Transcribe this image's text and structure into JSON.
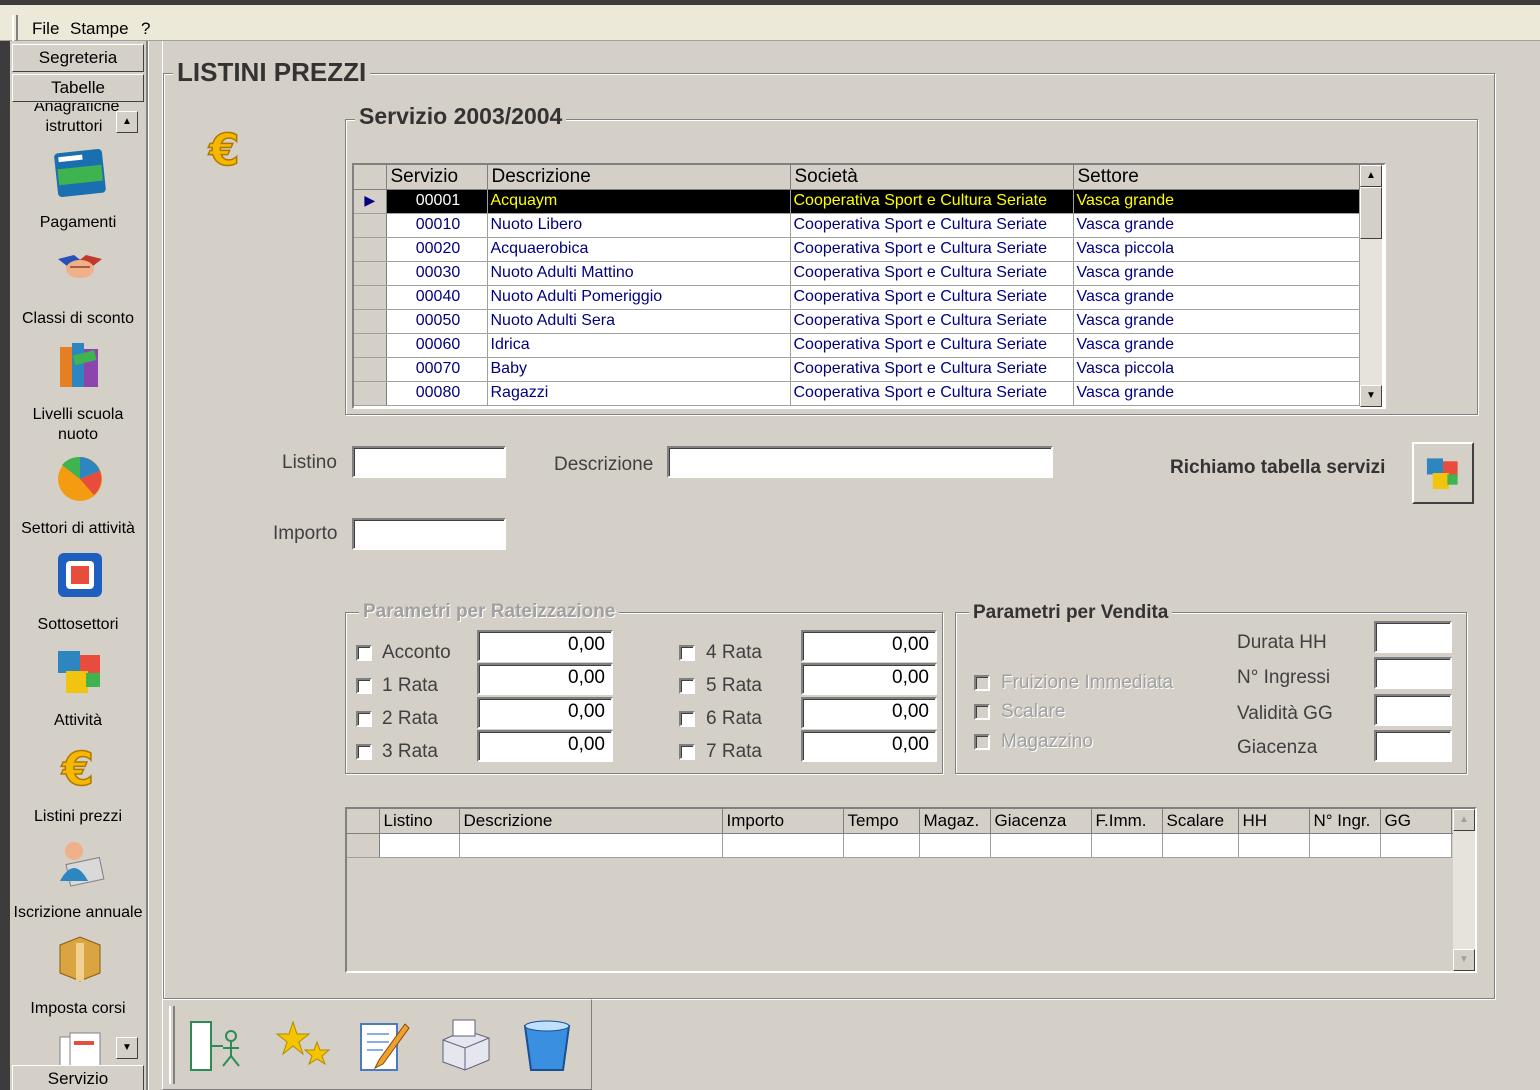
{
  "menu": [
    "File",
    "Stampe",
    "?"
  ],
  "sidebar": {
    "top_buttons": [
      "Segreteria",
      "Tabelle"
    ],
    "items": [
      {
        "label": "Anagrafiche istruttori",
        "icon": "instructor-icon"
      },
      {
        "label": "Pagamenti",
        "icon": "credit-card-icon"
      },
      {
        "label": "Classi di sconto",
        "icon": "handshake-icon"
      },
      {
        "label": "Livelli scuola nuoto",
        "icon": "books-icon"
      },
      {
        "label": "Settori di attività",
        "icon": "pie-chart-icon"
      },
      {
        "label": "Sottosettori",
        "icon": "frame-icon"
      },
      {
        "label": "Attività",
        "icon": "cubes-icon"
      },
      {
        "label": "Listini prezzi",
        "icon": "euro-icon"
      },
      {
        "label": "Iscrizione annuale",
        "icon": "user-card-icon"
      },
      {
        "label": "Imposta corsi",
        "icon": "box-icon"
      }
    ],
    "bottom_button": "Servizio"
  },
  "page_title": "LISTINI PREZZI",
  "services": {
    "title": "Servizio 2003/2004",
    "columns": [
      "Servizio",
      "Descrizione",
      "Società",
      "Settore"
    ],
    "rows": [
      [
        "00001",
        "Acquaym",
        "Cooperativa Sport e Cultura Seriate",
        "Vasca grande"
      ],
      [
        "00010",
        "Nuoto Libero",
        "Cooperativa Sport e Cultura Seriate",
        "Vasca grande"
      ],
      [
        "00020",
        "Acquaerobica",
        "Cooperativa Sport e Cultura Seriate",
        "Vasca piccola"
      ],
      [
        "00030",
        "Nuoto Adulti Mattino",
        "Cooperativa Sport e Cultura Seriate",
        "Vasca grande"
      ],
      [
        "00040",
        "Nuoto Adulti Pomeriggio",
        "Cooperativa Sport e Cultura Seriate",
        "Vasca grande"
      ],
      [
        "00050",
        "Nuoto Adulti Sera",
        "Cooperativa Sport e Cultura Seriate",
        "Vasca grande"
      ],
      [
        "00060",
        "Idrica",
        "Cooperativa Sport e Cultura Seriate",
        "Vasca grande"
      ],
      [
        "00070",
        "Baby",
        "Cooperativa Sport e Cultura Seriate",
        "Vasca piccola"
      ],
      [
        "00080",
        "Ragazzi",
        "Cooperativa Sport e Cultura Seriate",
        "Vasca grande"
      ]
    ],
    "selected_index": 0
  },
  "form": {
    "listino_label": "Listino",
    "listino_value": "",
    "descrizione_label": "Descrizione",
    "descrizione_value": "",
    "importo_label": "Importo",
    "importo_value": "",
    "richiamo_label": "Richiamo tabella servizi"
  },
  "rate": {
    "title": "Parametri per Rateizzazione",
    "left": [
      {
        "label": "Acconto",
        "value": "0,00"
      },
      {
        "label": "1 Rata",
        "value": "0,00"
      },
      {
        "label": "2 Rata",
        "value": "0,00"
      },
      {
        "label": "3 Rata",
        "value": "0,00"
      }
    ],
    "right": [
      {
        "label": "4 Rata",
        "value": "0,00"
      },
      {
        "label": "5 Rata",
        "value": "0,00"
      },
      {
        "label": "6 Rata",
        "value": "0,00"
      },
      {
        "label": "7 Rata",
        "value": "0,00"
      }
    ]
  },
  "vendita": {
    "title": "Parametri per Vendita",
    "checks": [
      "Fruizione Immediata",
      "Scalare",
      "Magazzino"
    ],
    "fields": [
      "Durata HH",
      "N° Ingressi",
      "Validità GG",
      "Giacenza"
    ]
  },
  "listini_grid": {
    "columns": [
      "Listino",
      "Descrizione",
      "Importo",
      "Tempo",
      "Magaz.",
      "Giacenza",
      "F.Imm.",
      "Scalare",
      "HH",
      "N° Ingr.",
      "GG"
    ]
  },
  "toolbar": [
    "exit-icon",
    "new-icon",
    "edit-icon",
    "print-icon",
    "delete-icon"
  ],
  "colors": {
    "selection_bg": "#000000",
    "selection_text": "#ffff00",
    "grid_text": "#000080",
    "face": "#d4d0c8"
  }
}
